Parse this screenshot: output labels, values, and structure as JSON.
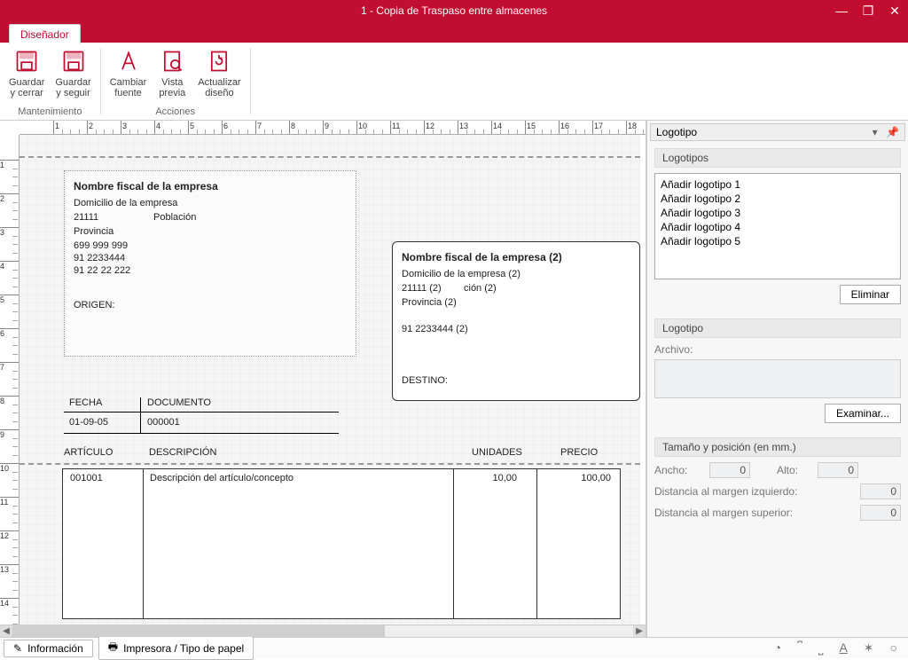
{
  "window": {
    "title": "1 - Copia de Traspaso entre almacenes"
  },
  "tab": {
    "label": "Diseñador"
  },
  "ribbon": {
    "group1": {
      "name": "Mantenimiento",
      "guardar_cerrar_1": "Guardar",
      "guardar_cerrar_2": "y cerrar",
      "guardar_seguir_1": "Guardar",
      "guardar_seguir_2": "y seguir"
    },
    "group2": {
      "name": "Acciones",
      "cambiar_fuente_1": "Cambiar",
      "cambiar_fuente_2": "fuente",
      "vista_previa_1": "Vista",
      "vista_previa_2": "previa",
      "actualizar_1": "Actualizar",
      "actualizar_2": "diseño"
    }
  },
  "canvas": {
    "origen": {
      "nombre": "Nombre fiscal de la empresa",
      "domicilio": "Domicilio de la empresa",
      "cp": "21111",
      "poblacion": "Población",
      "provincia": "Provincia",
      "tel1": "699 999 999",
      "tel2": "91 2233444",
      "tel3": "91 22 22 222",
      "label": "ORIGEN:"
    },
    "destino": {
      "nombre": "Nombre fiscal de la empresa (2)",
      "domicilio": "Domicilio de la empresa (2)",
      "cp": "21111 (2)",
      "poblacion": "ción (2)",
      "provincia": "Provincia (2)",
      "tel": "91 2233444 (2)",
      "label": "DESTINO:"
    },
    "fecha_label": "FECHA",
    "fecha_value": "01-09-05",
    "doc_label": "DOCUMENTO",
    "doc_value": "000001",
    "cols": {
      "articulo": "ARTÍCULO",
      "descripcion": "DESCRIPCIÓN",
      "unidades": "UNIDADES",
      "precio": "PRECIO"
    },
    "row": {
      "articulo": "001001",
      "descripcion": "Descripción del artículo/concepto",
      "unidades": "10,00",
      "precio": "100,00"
    }
  },
  "sidepanel": {
    "header": "Logotipo",
    "logotipos_title": "Logotipos",
    "items": [
      "Añadir logotipo 1",
      "Añadir logotipo 2",
      "Añadir logotipo 3",
      "Añadir logotipo 4",
      "Añadir logotipo 5"
    ],
    "eliminar": "Eliminar",
    "logotipo_title": "Logotipo",
    "archivo_label": "Archivo:",
    "examinar": "Examinar...",
    "tamano_title": "Tamaño y posición (en mm.)",
    "ancho_label": "Ancho:",
    "ancho_val": "0",
    "alto_label": "Alto:",
    "alto_val": "0",
    "dist_izq_label": "Distancia al margen izquierdo:",
    "dist_izq_val": "0",
    "dist_sup_label": "Distancia al margen superior:",
    "dist_sup_val": "0"
  },
  "statusbar": {
    "informacion": "Información",
    "impresora": "Impresora / Tipo de papel"
  }
}
